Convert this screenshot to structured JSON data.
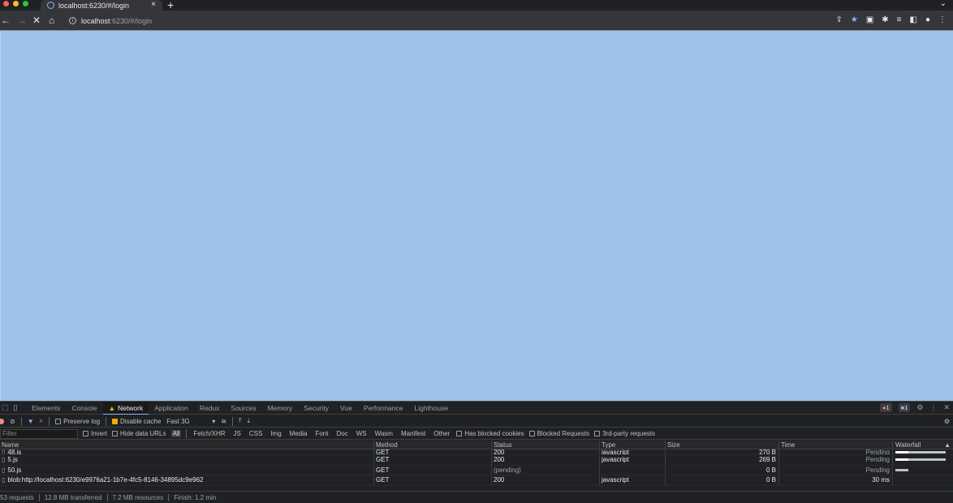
{
  "browser": {
    "tab_title": "localhost:6230/#/login",
    "tab_close": "×",
    "new_tab": "+",
    "tab_menu": "⌄",
    "url_host": "localhost",
    "url_rest": ":6230/#/login",
    "colors": {
      "close": "#ff5f57",
      "minimize": "#febc2e",
      "zoom": "#28c840"
    }
  },
  "devtools": {
    "tabs": [
      "Elements",
      "Console",
      "Network",
      "Application",
      "Redux",
      "Sources",
      "Memory",
      "Security",
      "Vue",
      "Performance",
      "Lighthouse"
    ],
    "active_tab": "Network",
    "error_count": "1",
    "message_count": "1",
    "controls": {
      "preserve_log": "Preserve log",
      "disable_cache": "Disable cache",
      "throttle": "Fast 3G"
    },
    "filter": {
      "placeholder": "Filter",
      "invert": "Invert",
      "hide_data_urls": "Hide data URLs",
      "types": [
        "All",
        "Fetch/XHR",
        "JS",
        "CSS",
        "Img",
        "Media",
        "Font",
        "Doc",
        "WS",
        "Wasm",
        "Manifest",
        "Other"
      ],
      "has_blocked_cookies": "Has blocked cookies",
      "blocked_requests": "Blocked Requests",
      "third_party": "3rd-party requests"
    },
    "columns": {
      "name": "Name",
      "method": "Method",
      "status": "Status",
      "type": "Type",
      "size": "Size",
      "time": "Time",
      "waterfall": "Waterfall"
    },
    "rows": [
      {
        "name": "48.js",
        "method": "GET",
        "status": "200",
        "type": "javascript",
        "size": "270 B",
        "time": "Pending",
        "fill": 0.25
      },
      {
        "name": "5.js",
        "method": "GET",
        "status": "200",
        "type": "javascript",
        "size": "269 B",
        "time": "Pending",
        "fill": 0.25
      },
      {
        "name": "50.js",
        "method": "GET",
        "status": "(pending)",
        "type": "",
        "size": "0 B",
        "time": "Pending",
        "fill": 0
      },
      {
        "name": "blob:http://localhost:6230/e9976a21-1b7e-4fc5-8146-34895dc9e962",
        "method": "GET",
        "status": "200",
        "type": "javascript",
        "size": "0 B",
        "time": "30 ms",
        "fill": 0
      }
    ],
    "status_bar": {
      "requests": "53 requests",
      "transferred": "12.8 MB transferred",
      "resources": "7.2 MB resources",
      "finish": "Finish: 1.2 min"
    }
  }
}
